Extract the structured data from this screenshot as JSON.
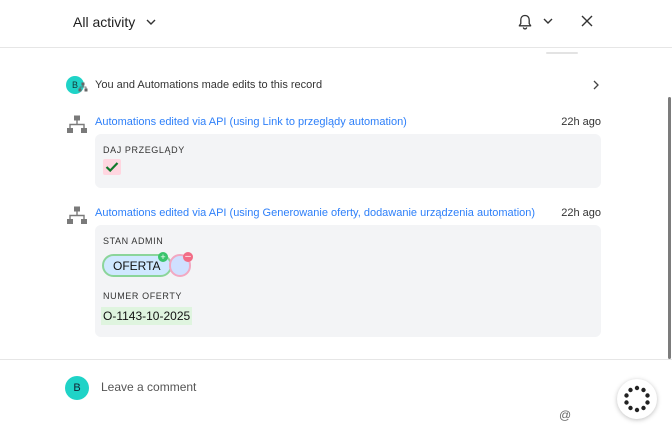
{
  "header": {
    "filter_label": "All activity",
    "icons": [
      "chevron-down-icon",
      "bell-icon",
      "chevron-down-icon",
      "close-icon"
    ]
  },
  "summary": {
    "avatar_letter": "B",
    "text": "You and Automations made edits to this record"
  },
  "activities": [
    {
      "title": "Automations edited via API (using Link to przeglądy automation)",
      "time": "22h ago",
      "field_label": "DAJ PRZEGLĄDY",
      "field_value": "checked"
    },
    {
      "title": "Automations edited via API (using Generowanie oferty, dodawanie urządzenia automation)",
      "time": "22h ago",
      "field1_label": "STAN ADMIN",
      "added_option": "OFERTA",
      "field2_label": "NUMER OFERTY",
      "field2_value": "O-1143-10-2025"
    }
  ],
  "composer": {
    "avatar_letter": "B",
    "placeholder": "Leave a comment",
    "mention_symbol": "@"
  },
  "colors": {
    "link": "#2d7ff9",
    "avatar": "#1fd3c7",
    "added_border": "#8bd59a",
    "removed_border": "#f2a8c2",
    "card_bg": "#f3f4f6"
  }
}
